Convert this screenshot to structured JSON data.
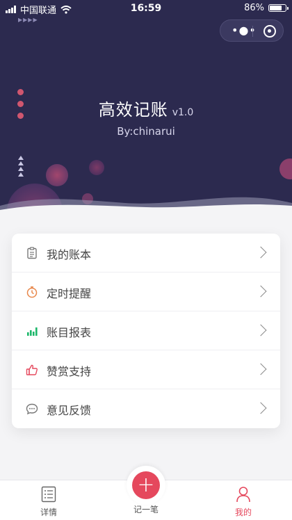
{
  "status_bar": {
    "carrier": "中国联通",
    "time": "16:59",
    "battery": "86%",
    "battery_level": 0.86
  },
  "header": {
    "title": "高效记账",
    "version": "v1.0",
    "author": "By:chinarui"
  },
  "menu": {
    "items": [
      {
        "label": "我的账本",
        "icon": "ledger-icon"
      },
      {
        "label": "定时提醒",
        "icon": "stopwatch-icon"
      },
      {
        "label": "账目报表",
        "icon": "bar-chart-icon"
      },
      {
        "label": "赞赏支持",
        "icon": "thumbs-up-icon"
      },
      {
        "label": "意见反馈",
        "icon": "chat-bubble-icon"
      }
    ]
  },
  "tabbar": {
    "details": "详情",
    "add": "记一笔",
    "add_symbol": "+",
    "mine": "我的"
  },
  "colors": {
    "header_bg": "#2c2a4f",
    "accent": "#e5485d",
    "page_bg": "#f4f4f6"
  }
}
